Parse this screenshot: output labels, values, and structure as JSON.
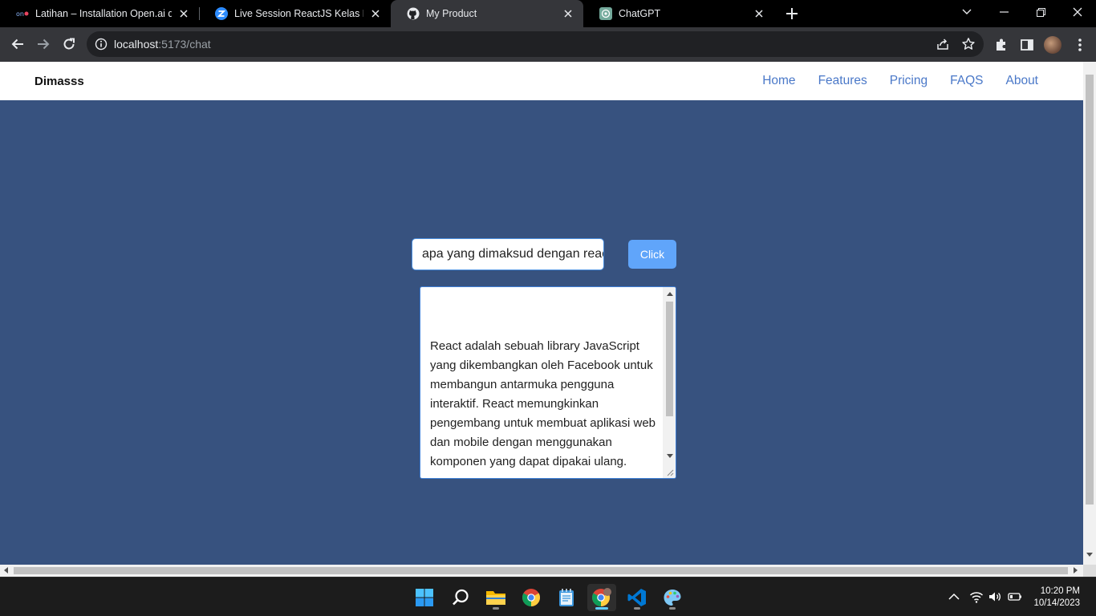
{
  "browser": {
    "tabs": [
      {
        "title": "Latihan – Installation Open.ai di React",
        "favicon": "openai-docs-icon",
        "active": false
      },
      {
        "title": "Live Session ReactJS Kelas D_Kampus Merdeka",
        "favicon": "zoom-icon",
        "active": false
      },
      {
        "title": "My Product",
        "favicon": "github-icon",
        "active": true
      },
      {
        "title": "ChatGPT",
        "favicon": "chatgpt-icon",
        "active": false
      }
    ],
    "address": {
      "host": "localhost",
      "path": ":5173/chat"
    }
  },
  "page": {
    "brand": "Dimasss",
    "nav": [
      "Home",
      "Features",
      "Pricing",
      "FAQS",
      "About"
    ],
    "prompt_value": "apa yang dimaksud dengan react",
    "button_label": "Click",
    "answer": "React adalah sebuah library JavaScript yang dikembangkan oleh Facebook untuk membangun antarmuka pengguna interaktif. React memungkinkan pengembang untuk membuat aplikasi web dan mobile dengan menggunakan komponen yang dapat dipakai ulang."
  },
  "taskbar": {
    "apps": [
      "windows-start-icon",
      "search-icon",
      "file-explorer-icon",
      "chrome-icon",
      "notepad-icon",
      "chrome-profile-icon",
      "vscode-icon",
      "paint-icon"
    ],
    "time": "10:20 PM",
    "date": "10/14/2023"
  },
  "colors": {
    "page_background": "#37527f",
    "nav_link": "#4a78c8",
    "button": "#60a5fa"
  }
}
